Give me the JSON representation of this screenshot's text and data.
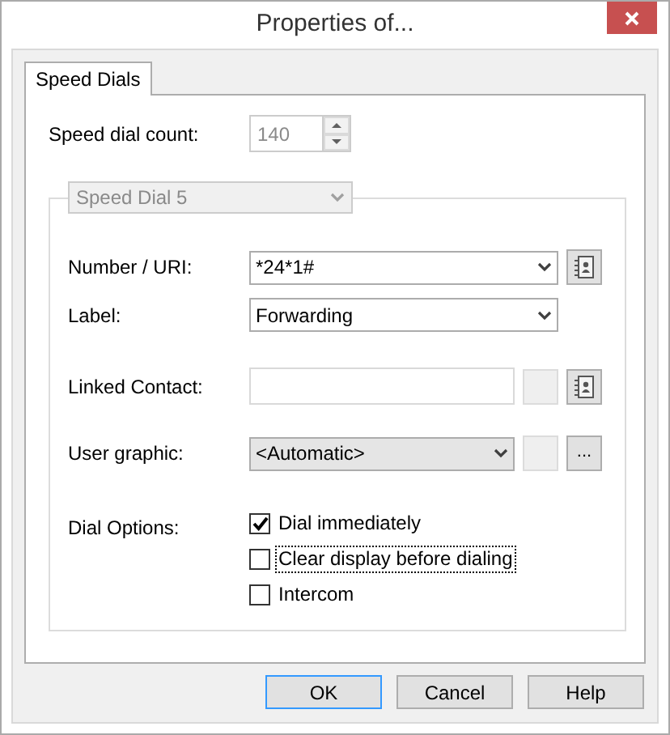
{
  "window": {
    "title": "Properties of..."
  },
  "tabs": [
    {
      "label": "Speed Dials",
      "selected": true
    }
  ],
  "speed_dial_count": {
    "label": "Speed dial count:",
    "value": "140",
    "disabled": true
  },
  "speed_dial_group": {
    "selector": {
      "value": "Speed Dial 5",
      "disabled": true
    },
    "fields": [
      {
        "kind": "combo",
        "label": "Number / URI:",
        "value": "*24*1#",
        "disabled": false,
        "buttons": [
          {
            "kind": "contact",
            "disabled": false
          }
        ]
      },
      {
        "kind": "combo",
        "label": "Label:",
        "value": "Forwarding",
        "disabled": false
      },
      {
        "kind": "text",
        "label": "Linked Contact:",
        "disabled": true,
        "buttons": [
          {
            "kind": "blank",
            "disabled": true
          },
          {
            "kind": "contact",
            "disabled": false
          }
        ]
      },
      {
        "kind": "combo",
        "label": "User graphic:",
        "value": "<Automatic>",
        "disabled": false,
        "buttons": [
          {
            "kind": "blank",
            "disabled": true
          },
          {
            "kind": "browse",
            "label": "...",
            "disabled": false
          }
        ]
      }
    ],
    "dial_options": {
      "label": "Dial Options:",
      "options": [
        {
          "label": "Dial immediately",
          "checked": true,
          "focused": false
        },
        {
          "label": "Clear display before dialing",
          "checked": false,
          "focused": true
        },
        {
          "label": "Intercom",
          "checked": false,
          "focused": false
        }
      ]
    }
  },
  "buttons": [
    {
      "label": "OK",
      "default": true
    },
    {
      "label": "Cancel",
      "default": false
    },
    {
      "label": "Help",
      "default": false
    }
  ]
}
